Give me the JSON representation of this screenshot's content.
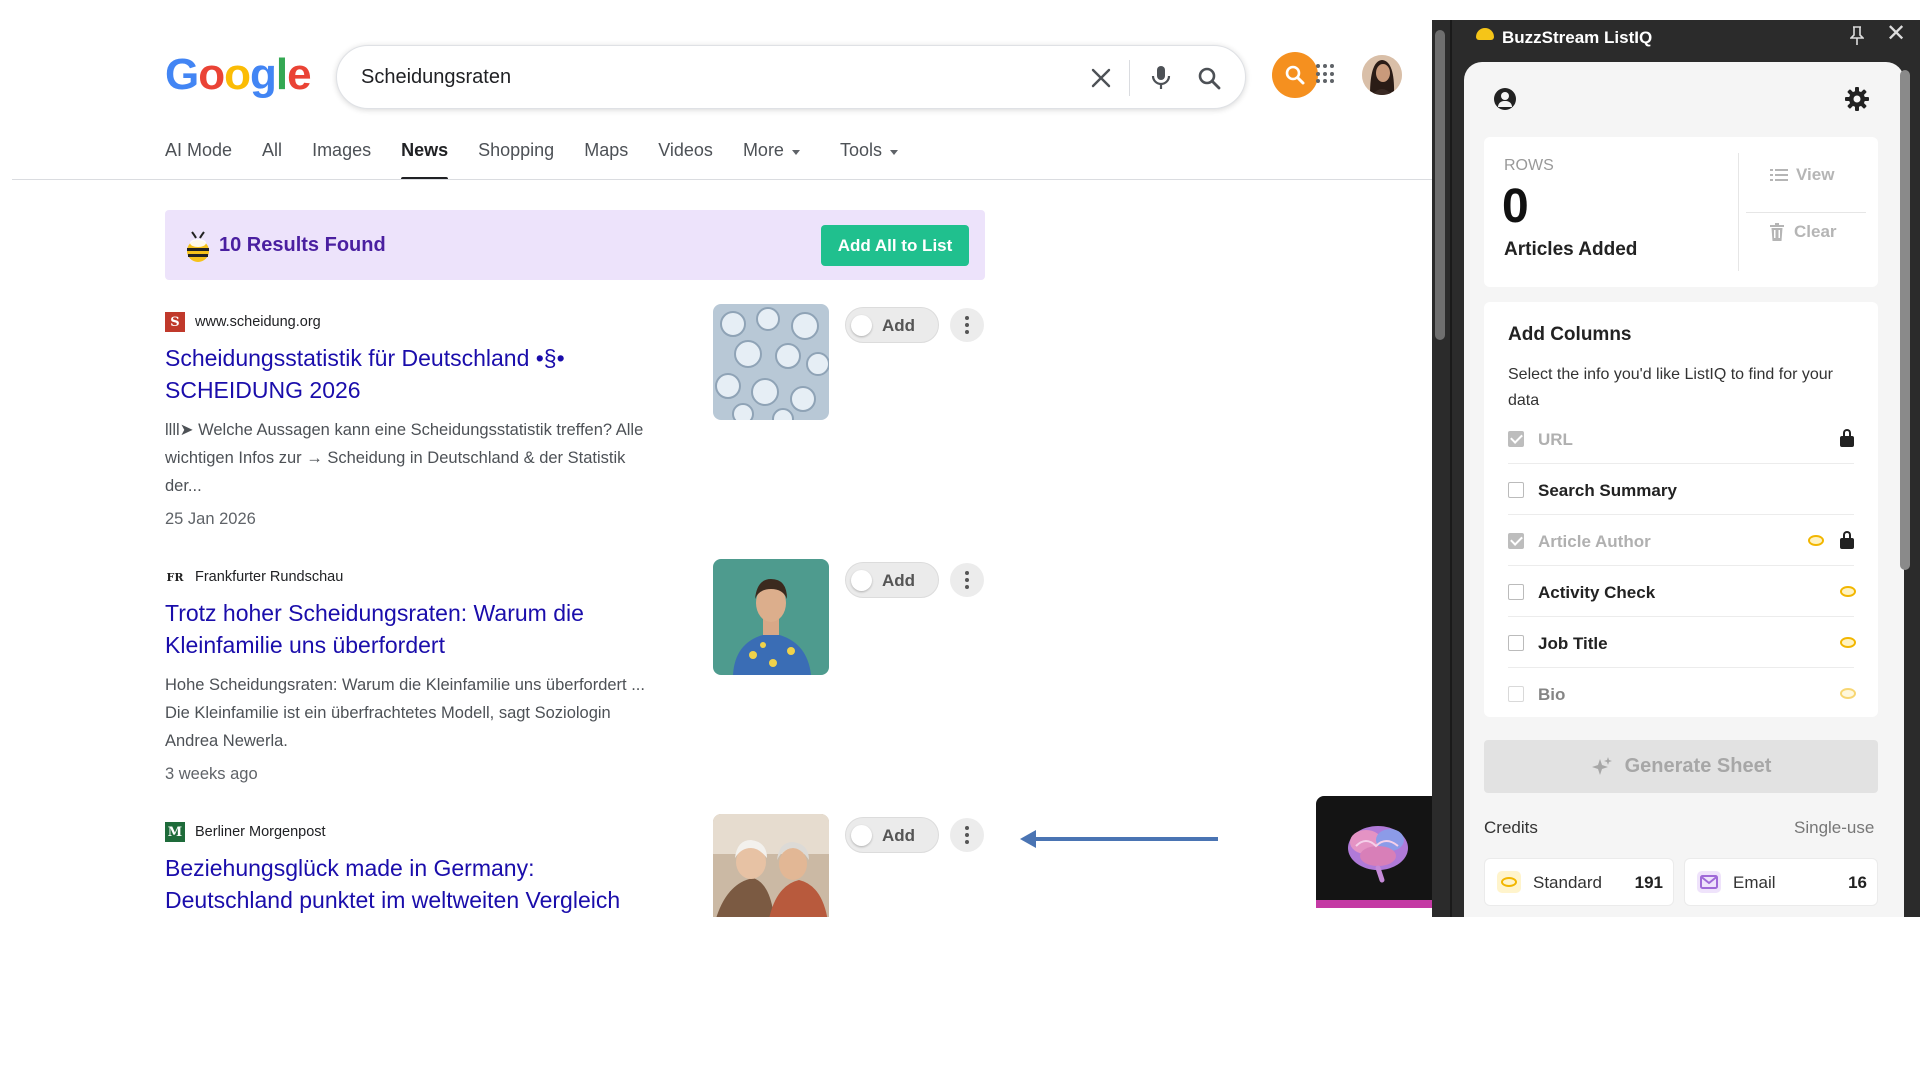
{
  "google": {
    "logo_letters": [
      {
        "ch": "G",
        "color": "#4285F4"
      },
      {
        "ch": "o",
        "color": "#EA4335"
      },
      {
        "ch": "o",
        "color": "#FBBC05"
      },
      {
        "ch": "g",
        "color": "#4285F4"
      },
      {
        "ch": "l",
        "color": "#34A853"
      },
      {
        "ch": "e",
        "color": "#EA4335"
      }
    ],
    "search_query": "Scheidungsraten",
    "icons": [
      "close-icon",
      "mic-icon",
      "search-icon",
      "buzzstream-extension-icon",
      "apps-grid-icon",
      "profile-avatar"
    ]
  },
  "tabs": [
    {
      "label": "AI Mode",
      "active": false
    },
    {
      "label": "All",
      "active": false
    },
    {
      "label": "Images",
      "active": false
    },
    {
      "label": "News",
      "active": true
    },
    {
      "label": "Shopping",
      "active": false
    },
    {
      "label": "Maps",
      "active": false
    },
    {
      "label": "Videos",
      "active": false
    },
    {
      "label": "More",
      "active": false,
      "dropdown": true
    },
    {
      "label": "Tools",
      "active": false,
      "dropdown": true
    }
  ],
  "banner": {
    "text": "10 Results Found",
    "button": "Add All to List",
    "accent": "#20c08e",
    "background": "#ede3fb"
  },
  "results": [
    {
      "source": "www.scheidung.org",
      "favicon": "S",
      "favicon_color": "#c0392b",
      "title_line1": "Scheidungsstatistik für Deutschland •§•",
      "title_line2": "SCHEIDUNG 2026",
      "snippet_line1": "llll➤ Welche Aussagen kann eine Scheidungsstatistik treffen? Alle",
      "snippet_line2": "wichtigen Infos zur → Scheidung in Deutschland & der Statistik",
      "snippet_line3": "der...",
      "date": "25 Jan 2026",
      "add_label": "Add"
    },
    {
      "source": "Frankfurter Rundschau",
      "favicon": "FR",
      "favicon_color": "#ffffff",
      "title_line1": "Trotz hoher Scheidungsraten: Warum die",
      "title_line2": "Kleinfamilie uns überfordert",
      "snippet_line1": "Hohe Scheidungsraten: Warum die Kleinfamilie uns überfordert ...",
      "snippet_line2": "Die Kleinfamilie ist ein überfrachtetes Modell, sagt Soziologin",
      "snippet_line3": "Andrea Newerla.",
      "date": "3 weeks ago",
      "add_label": "Add"
    },
    {
      "source": "Berliner Morgenpost",
      "favicon": "M",
      "favicon_color": "#1e6b3a",
      "title_line1": "Beziehungsglück made in Germany:",
      "title_line2": "Deutschland punktet im weltweiten Vergleich",
      "add_label": "Add"
    }
  ],
  "panel": {
    "title": "BuzzStream ListIQ",
    "rows_label": "ROWS",
    "rows_count": "0",
    "rows_sub": "Articles Added",
    "view_label": "View",
    "clear_label": "Clear",
    "add_columns_title": "Add Columns",
    "add_columns_desc": "Select the info you'd like ListIQ to find for your data",
    "columns": [
      {
        "name": "URL",
        "checked": true,
        "disabled": true,
        "lock": true,
        "coin": false
      },
      {
        "name": "Search Summary",
        "checked": false,
        "disabled": false,
        "lock": false,
        "coin": false
      },
      {
        "name": "Article Author",
        "checked": true,
        "disabled": true,
        "lock": true,
        "coin": true
      },
      {
        "name": "Activity Check",
        "checked": false,
        "disabled": false,
        "lock": false,
        "coin": true
      },
      {
        "name": "Job Title",
        "checked": false,
        "disabled": false,
        "lock": false,
        "coin": true
      },
      {
        "name": "Bio",
        "checked": false,
        "disabled": false,
        "lock": false,
        "coin": true
      }
    ],
    "generate_label": "Generate Sheet",
    "credits_label": "Credits",
    "single_use_label": "Single-use",
    "standard_label": "Standard",
    "standard_value": "191",
    "email_label": "Email",
    "email_value": "16"
  }
}
